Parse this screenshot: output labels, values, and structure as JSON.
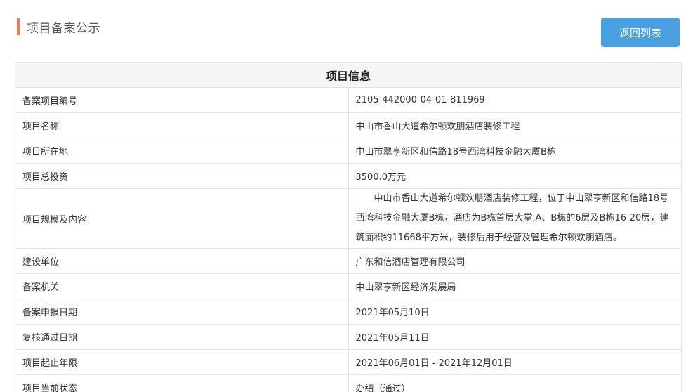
{
  "header": {
    "title": "项目备案公示",
    "back_button_label": "返回列表",
    "accent_color": "#f0785a",
    "button_color": "#4a9fe0"
  },
  "table": {
    "caption": "项目信息",
    "rows": [
      {
        "label": "备案项目编号",
        "value": "2105-442000-04-01-811969"
      },
      {
        "label": "项目名称",
        "value": "中山市香山大道希尔顿欢朋酒店装修工程"
      },
      {
        "label": "项目所在地",
        "value": "中山市翠亨新区和信路18号西湾科技金融大厦B栋"
      },
      {
        "label": "项目总投资",
        "value": "3500.0万元"
      },
      {
        "label": "项目规模及内容",
        "value": "中山市香山大道希尔顿欢朋酒店装修工程，位于中山翠亨新区和信路18号西湾科技金融大厦B栋，酒店为B栋首层大堂,A、B栋的6层及B栋16-20层，建筑面积约11668平方米，装修后用于经营及管理希尔顿欢朋酒店。"
      },
      {
        "label": "建设单位",
        "value": "广东和信酒店管理有限公司"
      },
      {
        "label": "备案机关",
        "value": "中山翠亨新区经济发展局"
      },
      {
        "label": "备案申报日期",
        "value": "2021年05月10日"
      },
      {
        "label": "复核通过日期",
        "value": "2021年05月11日"
      },
      {
        "label": "项目起止年限",
        "value": "2021年06月01日 - 2021年12月01日"
      },
      {
        "label": "项目当前状态",
        "value": "办结（通过）"
      }
    ]
  }
}
